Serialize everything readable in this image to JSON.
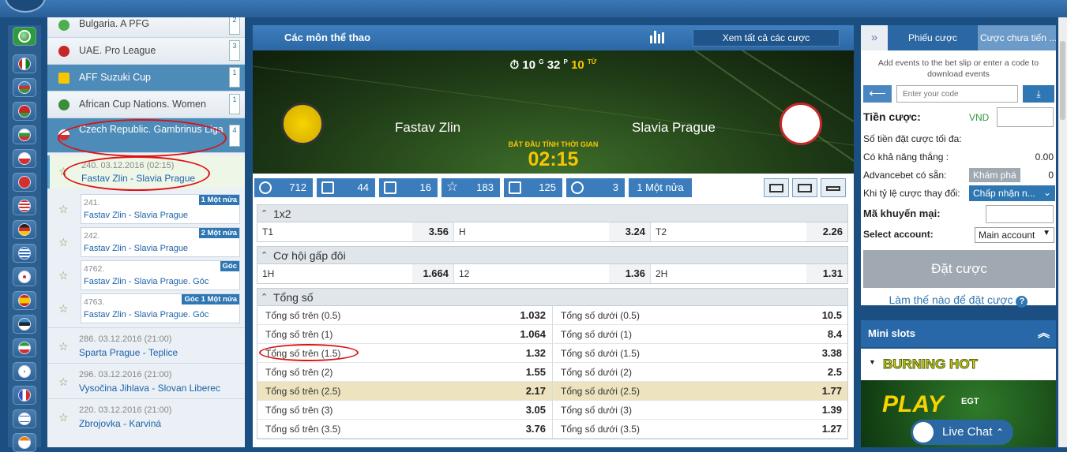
{
  "leagues": [
    {
      "name": "Bulgaria. A PFG",
      "count": "2",
      "flag": "#4caf50"
    },
    {
      "name": "UAE. Pro League",
      "count": "3",
      "flag": "#c62828"
    },
    {
      "name": "AFF Suzuki Cup",
      "count": "1",
      "flag": "#f7c600"
    },
    {
      "name": "African Cup Nations. Women",
      "count": "1",
      "flag": "#3a8d3a"
    },
    {
      "name": "Czech Republic. Gambrinus Liga",
      "count": "4",
      "flag": "#d32f2f"
    }
  ],
  "active_event": {
    "nr": "240. 03.12.2016 (02:15)",
    "teams": "Fastav Zlin - Slavia Prague"
  },
  "sub_events": [
    {
      "nr": "241.",
      "teams": "Fastav Zlin - Slavia Prague",
      "badge": "1 Một nửa"
    },
    {
      "nr": "242.",
      "teams": "Fastav Zlin - Slavia Prague",
      "badge": "2 Một nửa"
    },
    {
      "nr": "4762.",
      "teams": "Fastav Zlin - Slavia Prague. Góc",
      "badge": "Góc"
    },
    {
      "nr": "4763.",
      "teams": "Fastav Zlin - Slavia Prague. Góc",
      "badge": "Góc 1 Một nửa"
    }
  ],
  "events": [
    {
      "nr": "286. 03.12.2016 (21:00)",
      "teams": "Sparta Prague - Teplice"
    },
    {
      "nr": "296. 03.12.2016 (21:00)",
      "teams": "Vysočina Jihlava - Slovan Liberec"
    },
    {
      "nr": "220. 03.12.2016 (21:00)",
      "teams": "Zbrojovka - Karviná"
    }
  ],
  "header": {
    "title": "Các môn thể thao",
    "all_bets": "Xem tất cả các cược"
  },
  "match": {
    "timer": {
      "m": "10",
      "m_unit": "G",
      "s": "32",
      "s_unit": "P",
      "y": "10",
      "y_unit": "TỪ"
    },
    "home": "Fastav Zlin",
    "away": "Slavia Prague",
    "start_label": "BẮT ĐẦU TÍNH THỜI GIAN",
    "start_time": "02:15"
  },
  "stats": [
    {
      "icon": "target-icon",
      "value": "712"
    },
    {
      "icon": "updown-icon",
      "value": "44"
    },
    {
      "icon": "stats-icon",
      "value": "16"
    },
    {
      "icon": "star-icon",
      "value": "183"
    },
    {
      "icon": "trophy-icon",
      "value": "125"
    },
    {
      "icon": "timer-icon",
      "value": "3"
    }
  ],
  "half_label": "1 Một nửa",
  "markets": {
    "one_x_two": {
      "title": "1x2",
      "cells": [
        {
          "l": "T1",
          "o": "3.56"
        },
        {
          "l": "H",
          "o": "3.24"
        },
        {
          "l": "T2",
          "o": "2.26"
        }
      ]
    },
    "double": {
      "title": "Cơ hội gấp đôi",
      "cells": [
        {
          "l": "1H",
          "o": "1.664"
        },
        {
          "l": "12",
          "o": "1.36"
        },
        {
          "l": "2H",
          "o": "1.31"
        }
      ]
    },
    "total": {
      "title": "Tổng số",
      "rows": [
        {
          "ol": "Tổng số trên (0.5)",
          "oo": "1.032",
          "ul": "Tổng số dưới (0.5)",
          "uo": "10.5"
        },
        {
          "ol": "Tổng số trên (1)",
          "oo": "1.064",
          "ul": "Tổng số dưới (1)",
          "uo": "8.4"
        },
        {
          "ol": "Tổng số trên (1.5)",
          "oo": "1.32",
          "ul": "Tổng số dưới (1.5)",
          "uo": "3.38"
        },
        {
          "ol": "Tổng số trên (2)",
          "oo": "1.55",
          "ul": "Tổng số dưới (2)",
          "uo": "2.5"
        },
        {
          "ol": "Tổng số trên (2.5)",
          "oo": "2.17",
          "ul": "Tổng số dưới (2.5)",
          "uo": "1.77"
        },
        {
          "ol": "Tổng số trên (3)",
          "oo": "3.05",
          "ul": "Tổng số dưới (3)",
          "uo": "1.39"
        },
        {
          "ol": "Tổng số trên (3.5)",
          "oo": "3.76",
          "ul": "Tổng số dưới (3.5)",
          "uo": "1.27"
        }
      ]
    }
  },
  "betslip": {
    "tab1": "Phiếu cược",
    "tab2": "Cược chưa tiến ...",
    "info": "Add events to the bet slip or enter a code to download events",
    "code_placeholder": "Enter your code",
    "stake_label": "Tiền cược:",
    "currency": "VND",
    "max_label": "Số tiền đặt cược tối đa:",
    "win_label": "Có khả năng thắng :",
    "win_value": "0.00",
    "advance_label": "Advancebet có sẵn:",
    "explore": "Khám phá",
    "advance_value": "0",
    "odds_label": "Khi tỷ lệ cược thay đổi:",
    "odds_option": "Chấp nhận n...",
    "promo_label": "Mã khuyến mại:",
    "account_label": "Select account:",
    "account_option": "Main account",
    "place": "Đặt cược",
    "how": "Làm thế nào để đặt cược"
  },
  "mini": {
    "title": "Mini slots",
    "game": "BURNING HOT",
    "play": "PLAY",
    "brand": "EGT"
  },
  "chat": "Live Chat"
}
